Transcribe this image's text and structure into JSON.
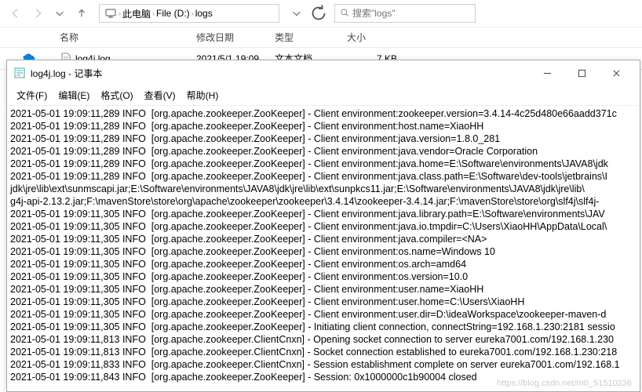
{
  "explorer": {
    "breadcrumb": {
      "seg1": "此电脑",
      "seg2": "File (D:)",
      "seg3": "logs"
    },
    "search_placeholder": "搜索\"logs\"",
    "columns": {
      "name": "名称",
      "date": "修改日期",
      "type": "类型",
      "size": "大小"
    },
    "file": {
      "name": "log4j.log",
      "date": "2021/5/1 19:09",
      "type": "文本文档",
      "size": "7 KB"
    }
  },
  "notepad": {
    "title": "log4j.log - 记事本",
    "menu": {
      "file": "文件(F)",
      "edit": "编辑(E)",
      "format": "格式(O)",
      "view": "查看(V)",
      "help": "帮助(H)"
    },
    "lines": [
      "2021-05-01 19:09:11,289 INFO  [org.apache.zookeeper.ZooKeeper] - Client environment:zookeeper.version=3.4.14-4c25d480e66aadd371c",
      "2021-05-01 19:09:11,289 INFO  [org.apache.zookeeper.ZooKeeper] - Client environment:host.name=XiaoHH",
      "2021-05-01 19:09:11,289 INFO  [org.apache.zookeeper.ZooKeeper] - Client environment:java.version=1.8.0_281",
      "2021-05-01 19:09:11,289 INFO  [org.apache.zookeeper.ZooKeeper] - Client environment:java.vendor=Oracle Corporation",
      "2021-05-01 19:09:11,289 INFO  [org.apache.zookeeper.ZooKeeper] - Client environment:java.home=E:\\Software\\environments\\JAVA8\\jdk",
      "2021-05-01 19:09:11,289 INFO  [org.apache.zookeeper.ZooKeeper] - Client environment:java.class.path=E:\\Software\\dev-tools\\jetbrains\\I",
      "jdk\\jre\\lib\\ext\\sunmscapi.jar;E:\\Software\\environments\\JAVA8\\jdk\\jre\\lib\\ext\\sunpkcs11.jar;E:\\Software\\environments\\JAVA8\\jdk\\jre\\lib\\",
      "g4j-api-2.13.2.jar;F:\\mavenStore\\store\\org\\apache\\zookeeper\\zookeeper\\3.4.14\\zookeeper-3.4.14.jar;F:\\mavenStore\\store\\org\\slf4j\\slf4j-",
      "2021-05-01 19:09:11,305 INFO  [org.apache.zookeeper.ZooKeeper] - Client environment:java.library.path=E:\\Software\\environments\\JAV",
      "2021-05-01 19:09:11,305 INFO  [org.apache.zookeeper.ZooKeeper] - Client environment:java.io.tmpdir=C:\\Users\\XiaoHH\\AppData\\Local\\",
      "2021-05-01 19:09:11,305 INFO  [org.apache.zookeeper.ZooKeeper] - Client environment:java.compiler=<NA>",
      "2021-05-01 19:09:11,305 INFO  [org.apache.zookeeper.ZooKeeper] - Client environment:os.name=Windows 10",
      "2021-05-01 19:09:11,305 INFO  [org.apache.zookeeper.ZooKeeper] - Client environment:os.arch=amd64",
      "2021-05-01 19:09:11,305 INFO  [org.apache.zookeeper.ZooKeeper] - Client environment:os.version=10.0",
      "2021-05-01 19:09:11,305 INFO  [org.apache.zookeeper.ZooKeeper] - Client environment:user.name=XiaoHH",
      "2021-05-01 19:09:11,305 INFO  [org.apache.zookeeper.ZooKeeper] - Client environment:user.home=C:\\Users\\XiaoHH",
      "2021-05-01 19:09:11,305 INFO  [org.apache.zookeeper.ZooKeeper] - Client environment:user.dir=D:\\ideaWorkspace\\zookeeper-maven-d",
      "2021-05-01 19:09:11,305 INFO  [org.apache.zookeeper.ZooKeeper] - Initiating client connection, connectString=192.168.1.230:2181 sessio",
      "2021-05-01 19:09:11,813 INFO  [org.apache.zookeeper.ClientCnxn] - Opening socket connection to server eureka7001.com/192.168.1.230",
      "2021-05-01 19:09:11,813 INFO  [org.apache.zookeeper.ClientCnxn] - Socket connection established to eureka7001.com/192.168.1.230:218",
      "2021-05-01 19:09:11,833 INFO  [org.apache.zookeeper.ClientCnxn] - Session establishment complete on server eureka7001.com/192.168.1",
      "2021-05-01 19:09:11,843 INFO  [org.apache.zookeeper.ZooKeeper] - Session: 0x1000000c1b90004 closed"
    ]
  },
  "watermark": "https://blog.csdn.net/m0_51510236"
}
